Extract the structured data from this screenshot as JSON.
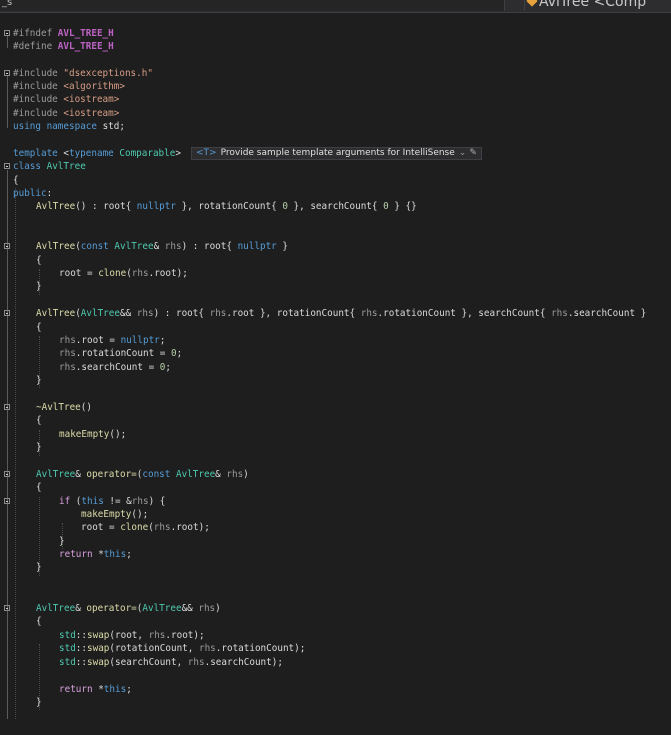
{
  "tabs": {
    "left_label": "_s",
    "right_label": "AvlTree <Comp"
  },
  "hint": {
    "tag": "<T>",
    "text": "Provide sample template arguments for IntelliSense",
    "caret": "⌄",
    "edit_icon": "pencil-icon"
  },
  "code": {
    "l1": [
      "#ifndef ",
      "AVL_TREE_H"
    ],
    "l2": [
      "#define ",
      "AVL_TREE_H"
    ],
    "l4": [
      "#include ",
      "\"dsexceptions.h\""
    ],
    "l5": [
      "#include ",
      "<algorithm>"
    ],
    "l6": [
      "#include ",
      "<iostream>"
    ],
    "l7": [
      "#include ",
      "<iostream>"
    ],
    "l8": [
      "using",
      " ",
      "namespace",
      " std;"
    ],
    "l10": [
      "template",
      " <",
      "typename",
      " ",
      "Comparable",
      ">"
    ],
    "l11": [
      "class",
      " ",
      "AvlTree"
    ],
    "l12": "{",
    "l13": [
      "public",
      ":"
    ],
    "l14": [
      "AvlTree",
      "() : ",
      "root",
      "{ ",
      "nullptr",
      " }, ",
      "rotationCount",
      "{ ",
      "0",
      " }, ",
      "searchCount",
      "{ ",
      "0",
      " } {}"
    ],
    "l17": [
      "AvlTree",
      "(",
      "const",
      " ",
      "AvlTree",
      "& ",
      "rhs",
      ") : ",
      "root",
      "{ ",
      "nullptr",
      " }"
    ],
    "l18": "{",
    "l19": [
      "root",
      " = ",
      "clone",
      "(",
      "rhs",
      ".",
      "root",
      ");"
    ],
    "l20": "}",
    "l22": [
      "AvlTree",
      "(",
      "AvlTree",
      "&& ",
      "rhs",
      ") : ",
      "root",
      "{ ",
      "rhs",
      ".",
      "root",
      " }, ",
      "rotationCount",
      "{ ",
      "rhs",
      ".",
      "rotationCount",
      " }, ",
      "searchCount",
      "{ ",
      "rhs",
      ".",
      "searchCount",
      " }"
    ],
    "l23": "{",
    "l24": [
      "rhs",
      ".",
      "root",
      " = ",
      "nullptr",
      ";"
    ],
    "l25": [
      "rhs",
      ".",
      "rotationCount",
      " = ",
      "0",
      ";"
    ],
    "l26": [
      "rhs",
      ".",
      "searchCount",
      " = ",
      "0",
      ";"
    ],
    "l27": "}",
    "l29": [
      "~AvlTree",
      "()"
    ],
    "l30": "{",
    "l31": [
      "makeEmpty",
      "();"
    ],
    "l32": "}",
    "l34": [
      "AvlTree",
      "& ",
      "operator=",
      "(",
      "const",
      " ",
      "AvlTree",
      "& ",
      "rhs",
      ")"
    ],
    "l35": "{",
    "l36": [
      "if",
      " (",
      "this",
      " != &",
      "rhs",
      ") {"
    ],
    "l37": [
      "makeEmpty",
      "();"
    ],
    "l38": [
      "root",
      " = ",
      "clone",
      "(",
      "rhs",
      ".",
      "root",
      ");"
    ],
    "l39": "}",
    "l40": [
      "return",
      " *",
      "this",
      ";"
    ],
    "l41": "}",
    "l44": [
      "AvlTree",
      "& ",
      "operator=",
      "(",
      "AvlTree",
      "&& ",
      "rhs",
      ")"
    ],
    "l45": "{",
    "l46": [
      "std",
      "::",
      "swap",
      "(",
      "root",
      ", ",
      "rhs",
      ".",
      "root",
      ");"
    ],
    "l47": [
      "std",
      "::",
      "swap",
      "(",
      "rotationCount",
      ", ",
      "rhs",
      ".",
      "rotationCount",
      ");"
    ],
    "l48": [
      "std",
      "::",
      "swap",
      "(",
      "searchCount",
      ", ",
      "rhs",
      ".",
      "searchCount",
      ");"
    ],
    "l50": [
      "return",
      " *",
      "this",
      ";"
    ],
    "l51": "}"
  }
}
